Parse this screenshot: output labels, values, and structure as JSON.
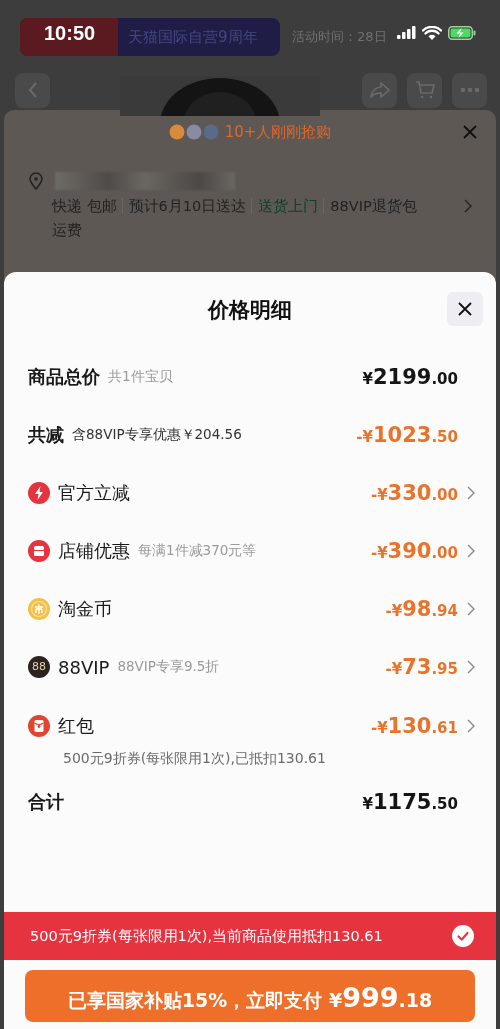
{
  "status_bar": {
    "time": "10:50"
  },
  "background_page": {
    "banner": {
      "brand": "天猫国际自营9周年",
      "event_time": "活动时间：28日"
    },
    "popup": {
      "buyers": "10+人刚刚抢购",
      "delivery": [
        {
          "text": "快递 包邮",
          "highlight": false
        },
        {
          "text": "预计6月10日送达",
          "highlight": false
        },
        {
          "text": "送货上门",
          "highlight": true
        },
        {
          "text": "88VIP退货包",
          "highlight": false
        }
      ],
      "delivery_wrap": "运费"
    }
  },
  "price_sheet": {
    "title": "价格明细",
    "rows": [
      {
        "kind": "total",
        "label": "商品总价",
        "note": "共1件宝贝",
        "currency": "¥",
        "whole": "2199",
        "fraction": ".00"
      },
      {
        "kind": "discount_sum",
        "label": "共减",
        "note": "含88VIP专享优惠￥204.56",
        "currency": "-¥",
        "whole": "1023",
        "fraction": ".50"
      },
      {
        "kind": "instant",
        "label": "官方立减",
        "currency": "-¥",
        "whole": "330",
        "fraction": ".00"
      },
      {
        "kind": "shop",
        "label": "店铺优惠",
        "note": "每满1件减370元等",
        "currency": "-¥",
        "whole": "390",
        "fraction": ".00"
      },
      {
        "kind": "coin",
        "label": "淘金币",
        "currency": "-¥",
        "whole": "98",
        "fraction": ".94"
      },
      {
        "kind": "vip",
        "badge": "88",
        "label": "88VIP",
        "note": "88VIP专享9.5折",
        "currency": "-¥",
        "whole": "73",
        "fraction": ".95"
      },
      {
        "kind": "packet",
        "label": "红包",
        "detail": "500元9折券(每张限用1次),已抵扣130.61",
        "currency": "-¥",
        "whole": "130",
        "fraction": ".61"
      },
      {
        "kind": "total",
        "label": "合计",
        "currency": "¥",
        "whole": "1175",
        "fraction": ".50"
      }
    ],
    "coupon_bar": {
      "text": "500元9折券(每张限用1次),当前商品使用抵扣130.61",
      "checked": true
    },
    "pay_button": {
      "label": "已享国家补贴15%，立即支付",
      "currency": "¥",
      "whole": "999",
      "fraction": ".18"
    }
  }
}
